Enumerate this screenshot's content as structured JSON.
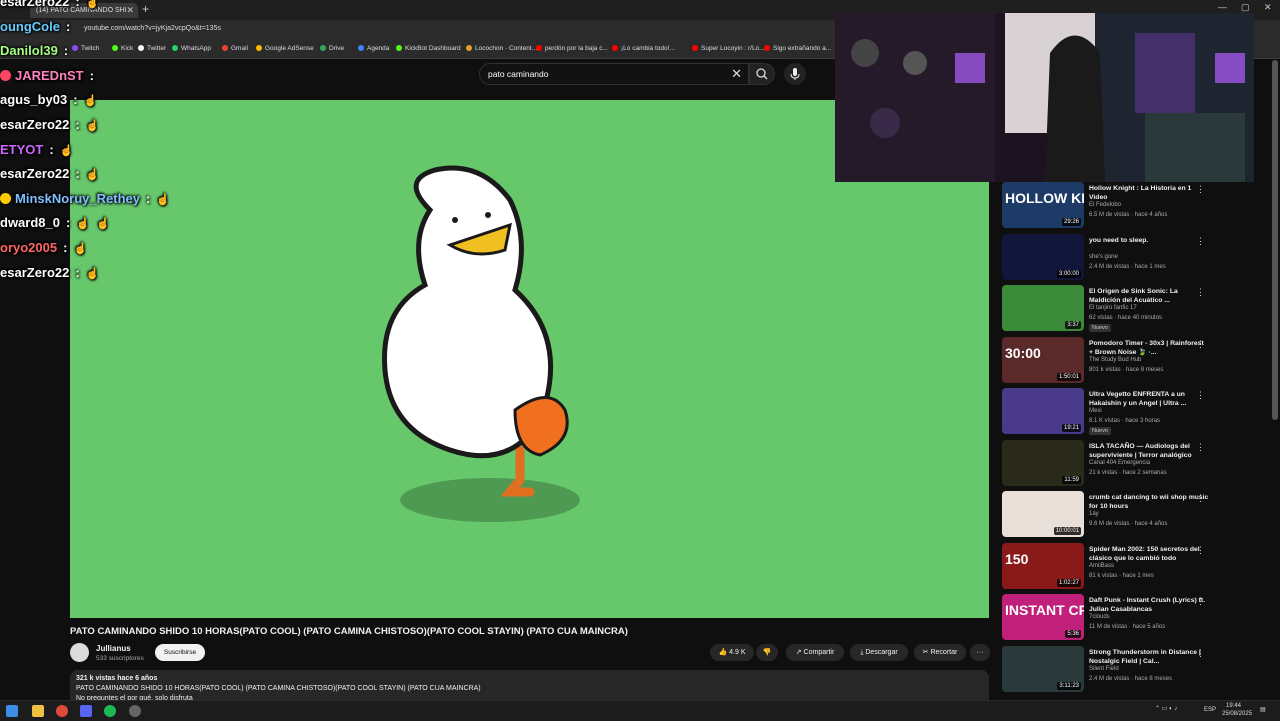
{
  "browser": {
    "tab_title": "(14) PATO CAMINANDO SHI",
    "url": "youtube.com/watch?v=jyKja2vcpQo&t=135s",
    "bookmarks": [
      {
        "label": "Twitch",
        "color": "#9147ff"
      },
      {
        "label": "Kick",
        "color": "#53fc18"
      },
      {
        "label": "Twitter",
        "color": "#ffffff"
      },
      {
        "label": "WhatsApp",
        "color": "#25d366"
      },
      {
        "label": "Gmail",
        "color": "#ea4335"
      },
      {
        "label": "Google AdSense",
        "color": "#fbbc04"
      },
      {
        "label": "Drive",
        "color": "#34a853"
      },
      {
        "label": "Agenda",
        "color": "#4285f4"
      },
      {
        "label": "KickBot Dashboard",
        "color": "#53fc18"
      },
      {
        "label": "Locochon · Content...",
        "color": "#e0a030"
      },
      {
        "label": "perdón por la baja c...",
        "color": "#ff0000"
      },
      {
        "label": "¡Lo cambia todo!...",
        "color": "#ff0000"
      },
      {
        "label": "Super Locoyin : r/Lo...",
        "color": "#ff0000"
      },
      {
        "label": "Sigo extrañando a...",
        "color": "#ff0000"
      }
    ]
  },
  "search": {
    "query": "pato caminando"
  },
  "video": {
    "title": "PATO CAMINANDO SHIDO 10 HORAS(PATO COOL) (PATO CAMINA CHISTOSO)(PATO COOL STAYIN) (PATO CUA MAINCRA)",
    "channel": "Jullianus",
    "subscribers": "533 suscriptores",
    "subscribe_label": "Suscribirse",
    "likes": "4.9 K",
    "share_label": "Compartir",
    "download_label": "Descargar",
    "clip_label": "Recortar",
    "description_stats": "321 k vistas  hace 6 años",
    "description_line": "PATO CAMINANDO SHIDO 10 HORAS(PATO COOL) (PATO CAMINA CHISTOSO)(PATO COOL STAYIN) (PATO CUA MAINCRA)",
    "description_more": "No preguntes el por qué, solo disfruta"
  },
  "sidebar": [
    {
      "title": "Hollow Knight : La Historia en 1 Video",
      "channel": "El Fedelobo",
      "meta": "6.5 M de vistas · hace 4 años",
      "duration": "29:26",
      "thumb_text": "HOLLOW KNIGHT",
      "thumb_color": "#1d3b66",
      "badge": ""
    },
    {
      "title": "you need to sleep.",
      "channel": "she's gone",
      "meta": "2.4 M de vistas · hace 1 mes",
      "duration": "3:00:00",
      "thumb_text": "",
      "thumb_color": "#12163a",
      "badge": ""
    },
    {
      "title": "El Origen de Sink Sonic: La Maldición del Acuático ...",
      "channel": "El tanjiro fanfic 17",
      "meta": "62 vistas · hace 40 minutos",
      "duration": "3:37",
      "thumb_text": "",
      "thumb_color": "#3a8a3a",
      "badge": "Nuevo"
    },
    {
      "title": "Pomodoro Timer - 30x3 | Rainforest + Brown Noise 🍃 ·...",
      "channel": "The Study Bud Hub",
      "meta": "801 k vistas · hace 8 meses",
      "duration": "1:50:01",
      "thumb_text": "30:00",
      "thumb_color": "#5a2a2a",
      "badge": ""
    },
    {
      "title": "Ultra Vegetto ENFRENTA a un Hakaishin y un Angel | Ultra ...",
      "channel": "Mexi",
      "meta": "8.1 K vistas · hace 3 horas",
      "duration": "19:21",
      "thumb_text": "",
      "thumb_color": "#4a3a8a",
      "badge": "Nuevo"
    },
    {
      "title": "ISLA TACAÑO — Audiologs del superviviente | Terror analógico",
      "channel": "Canal 404 Emergencia",
      "meta": "21 k vistas · hace 2 semanas",
      "duration": "11:59",
      "thumb_text": "",
      "thumb_color": "#2a2a1a",
      "badge": ""
    },
    {
      "title": "crumb cat dancing to wii shop music for 10 hours",
      "channel": "1ay",
      "meta": "9.6 M de vistas · hace 4 años",
      "duration": "10:00:01",
      "thumb_text": "",
      "thumb_color": "#e8e0d8",
      "badge": ""
    },
    {
      "title": "Spider Man 2002: 150 secretos del clásico que lo cambió todo",
      "channel": "AmiiBass",
      "meta": "81 k vistas · hace 1 mes",
      "duration": "1:02:27",
      "thumb_text": "150",
      "thumb_color": "#8a1a1a",
      "badge": ""
    },
    {
      "title": "Daft Punk - Instant Crush (Lyrics) ft. Julian Casablancas",
      "channel": "7clouds",
      "meta": "11 M de vistas · hace 5 años",
      "duration": "5:36",
      "thumb_text": "INSTANT CRUSH",
      "thumb_color": "#c0207a",
      "badge": ""
    },
    {
      "title": "Strong Thunderstorm in Distance | Nostalgic Field | Cal...",
      "channel": "Silent Field",
      "meta": "2.4 M de vistas · hace 8 meses",
      "duration": "3:11:23",
      "thumb_text": "",
      "thumb_color": "#2a3a3a",
      "badge": ""
    }
  ],
  "chat": [
    {
      "user": "esarZero22",
      "color": "#ffffff",
      "msg": ":",
      "hands": 1,
      "badge": ""
    },
    {
      "user": "oungCole",
      "color": "#66ccff",
      "msg": ":",
      "hands": 0,
      "badge": ""
    },
    {
      "user": "Danilol39",
      "color": "#a6ff80",
      "msg": ":",
      "hands": 0,
      "badge": ""
    },
    {
      "user": "JAREDnST",
      "color": "#ff80c0",
      "msg": ":",
      "hands": 0,
      "badge": "#ff4466"
    },
    {
      "user": "agus_by03",
      "color": "#ffffff",
      "msg": ":",
      "hands": 1,
      "badge": ""
    },
    {
      "user": "esarZero22",
      "color": "#ffffff",
      "msg": ":",
      "hands": 1,
      "badge": ""
    },
    {
      "user": "ETYOT",
      "color": "#cc66ff",
      "msg": ":",
      "hands": 1,
      "badge": ""
    },
    {
      "user": "esarZero22",
      "color": "#ffffff",
      "msg": ":",
      "hands": 1,
      "badge": ""
    },
    {
      "user": "MinskNoruy_Rethey",
      "color": "#80c0ff",
      "msg": ":",
      "hands": 1,
      "badge": "#ffcc00"
    },
    {
      "user": "dward8_0",
      "color": "#ffffff",
      "msg": ":",
      "hands": 2,
      "badge": ""
    },
    {
      "user": "oryo2005",
      "color": "#ff6666",
      "msg": ":",
      "hands": 1,
      "badge": ""
    },
    {
      "user": "esarZero22",
      "color": "#ffffff",
      "msg": ":",
      "hands": 1,
      "badge": ""
    }
  ],
  "taskbar": {
    "lang": "ESP",
    "time": "19:44",
    "date": "25/08/2025"
  },
  "colors": {
    "video_bg": "#66c76b",
    "page_bg": "#0f0f0f",
    "duck_beak": "#f0c020",
    "duck_foot": "#f07020"
  }
}
